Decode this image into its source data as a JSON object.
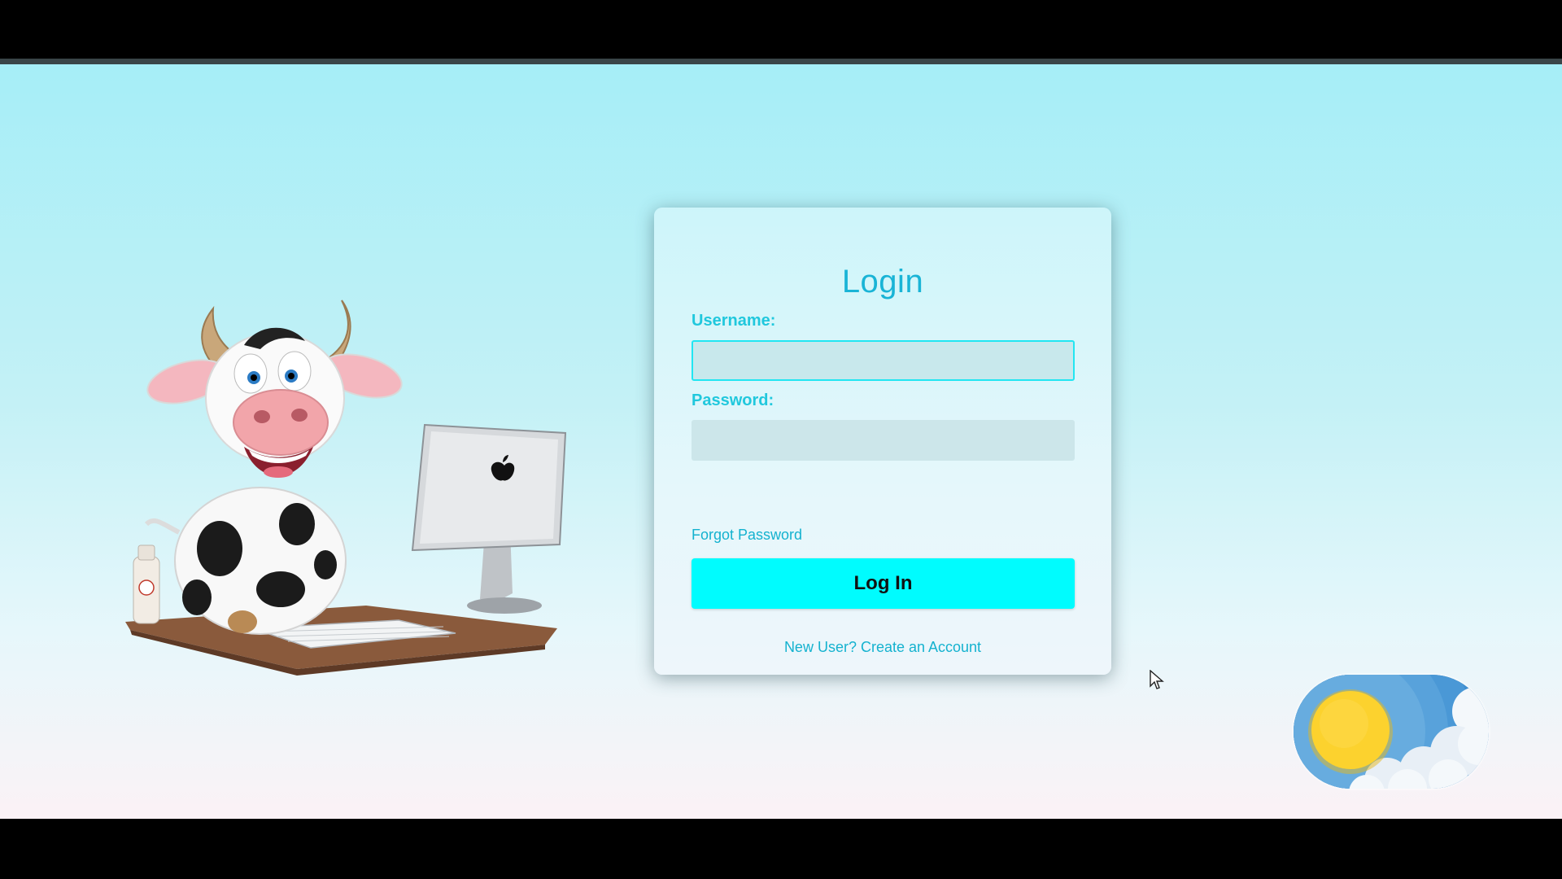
{
  "login": {
    "title": "Login",
    "username_label": "Username:",
    "username_value": "",
    "password_label": "Password:",
    "password_value": "",
    "forgot_password": "Forgot Password",
    "submit_label": "Log In",
    "register_link": "New User? Create an Account"
  },
  "theme_toggle": {
    "mode": "light",
    "icon": "sun-icon"
  },
  "illustration": {
    "subject": "cow-at-computer"
  },
  "colors": {
    "accent": "#19b4d6",
    "button": "#00fcfe",
    "focus_border": "#22e6f2",
    "sun": "#fcd22e",
    "sky": "#3f8fd0"
  }
}
